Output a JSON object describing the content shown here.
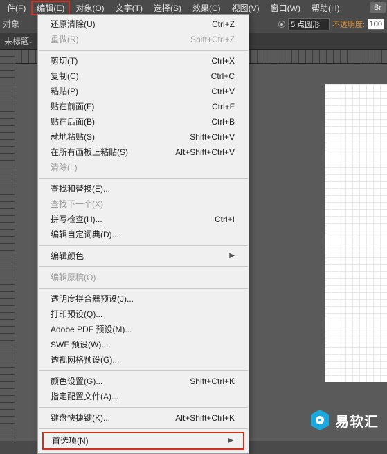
{
  "menubar": {
    "items": [
      "件(F)",
      "编辑(E)",
      "对象(O)",
      "文字(T)",
      "选择(S)",
      "效果(C)",
      "视图(V)",
      "窗口(W)",
      "帮助(H)"
    ],
    "highlightedIndex": 1,
    "br": "Br"
  },
  "toolbar": {
    "leftLabel": "对象",
    "strokeValue": "5 点圆形",
    "opacityLabel": "不透明度:",
    "opacityValue": "100"
  },
  "doctab": {
    "title": "未标题-"
  },
  "dropdown": {
    "groups": [
      [
        {
          "label": "还原清除(U)",
          "shortcut": "Ctrl+Z"
        },
        {
          "label": "重做(R)",
          "shortcut": "Shift+Ctrl+Z",
          "disabled": true
        }
      ],
      [
        {
          "label": "剪切(T)",
          "shortcut": "Ctrl+X"
        },
        {
          "label": "复制(C)",
          "shortcut": "Ctrl+C"
        },
        {
          "label": "粘贴(P)",
          "shortcut": "Ctrl+V"
        },
        {
          "label": "贴在前面(F)",
          "shortcut": "Ctrl+F"
        },
        {
          "label": "贴在后面(B)",
          "shortcut": "Ctrl+B"
        },
        {
          "label": "就地粘贴(S)",
          "shortcut": "Shift+Ctrl+V"
        },
        {
          "label": "在所有画板上粘贴(S)",
          "shortcut": "Alt+Shift+Ctrl+V"
        },
        {
          "label": "清除(L)",
          "disabled": true
        }
      ],
      [
        {
          "label": "查找和替换(E)..."
        },
        {
          "label": "查找下一个(X)",
          "disabled": true
        },
        {
          "label": "拼写检查(H)...",
          "shortcut": "Ctrl+I"
        },
        {
          "label": "编辑自定词典(D)..."
        }
      ],
      [
        {
          "label": "编辑颜色",
          "submenu": true
        }
      ],
      [
        {
          "label": "编辑原稿(O)",
          "disabled": true
        }
      ],
      [
        {
          "label": "透明度拼合器预设(J)..."
        },
        {
          "label": "打印预设(Q)..."
        },
        {
          "label": "Adobe PDF 预设(M)..."
        },
        {
          "label": "SWF 预设(W)..."
        },
        {
          "label": "透视网格预设(G)..."
        }
      ],
      [
        {
          "label": "颜色设置(G)...",
          "shortcut": "Shift+Ctrl+K"
        },
        {
          "label": "指定配置文件(A)..."
        }
      ],
      [
        {
          "label": "键盘快捷键(K)...",
          "shortcut": "Alt+Shift+Ctrl+K"
        }
      ]
    ],
    "highlighted": {
      "label": "首选项(N)",
      "submenu": true
    }
  },
  "watermark": {
    "text": "易软汇"
  }
}
